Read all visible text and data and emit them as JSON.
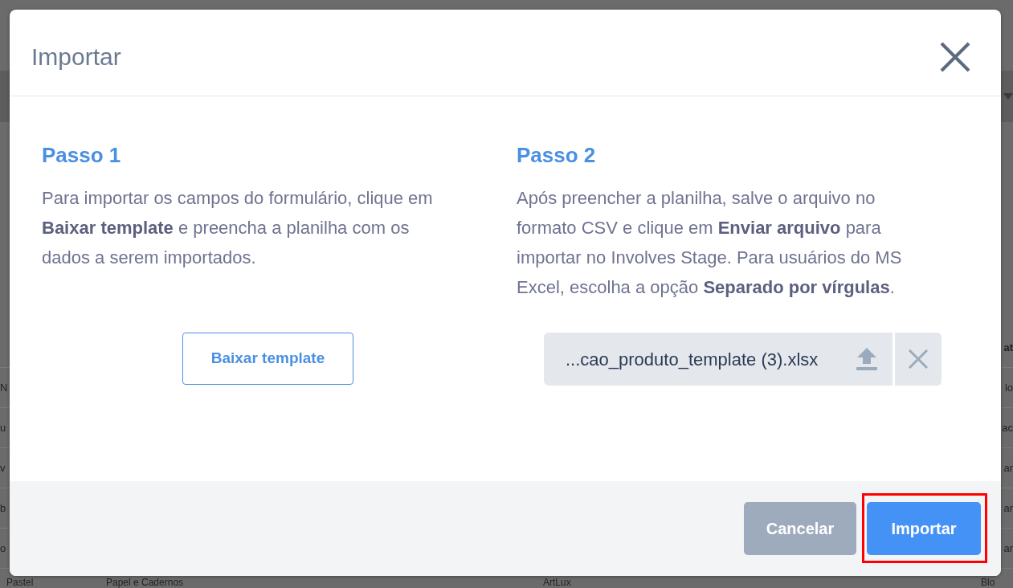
{
  "background": {
    "header_fragment": "at",
    "rows": [
      {
        "start": "N",
        "end": "lo"
      },
      {
        "start": "u",
        "end": "ac"
      },
      {
        "start": "v",
        "end": "ar"
      },
      {
        "start": "b",
        "end": "ar"
      },
      {
        "start": "o",
        "end": "ar"
      }
    ],
    "last_row": [
      "Pastel",
      "Papel e Cadernos",
      "ArtLux",
      "Blo"
    ]
  },
  "dialog": {
    "title": "Importar",
    "steps": [
      {
        "title": "Passo 1",
        "text": "Para importar os campos do formulário, clique em **Baixar template** e preencha a planilha com os dados a serem importados.",
        "kind": "button",
        "action_label": "Baixar template"
      },
      {
        "title": "Passo 2",
        "text": "Após preencher a planilha, salve o arquivo no formato CSV e clique em **Enviar arquivo** para importar no Involves Stage. Para usuários do MS Excel, escolha a opção **Separado por vírgulas**.",
        "kind": "file",
        "file_name": "...cao_produto_template (3).xlsx"
      }
    ],
    "buttons": [
      {
        "label": "Cancelar",
        "kind": "secondary",
        "highlighted": false
      },
      {
        "label": "Importar",
        "kind": "primary",
        "highlighted": true
      }
    ]
  }
}
